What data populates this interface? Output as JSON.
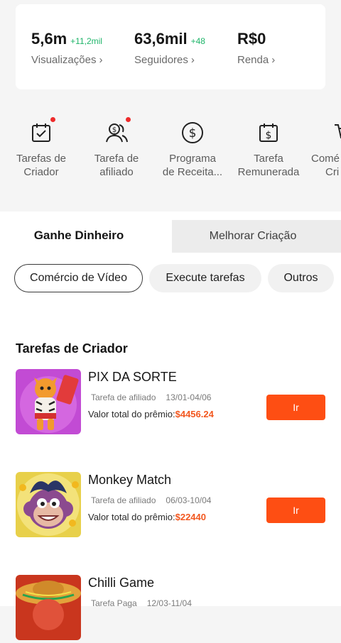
{
  "stats": [
    {
      "value": "5,6m",
      "delta": "+11,2mil",
      "label": "Visualizações",
      "chevron": "›"
    },
    {
      "value": "63,6mil",
      "delta": "+48",
      "label": "Seguidores",
      "chevron": "›"
    },
    {
      "value": "R$0",
      "delta": "",
      "label": "Renda",
      "chevron": "›"
    }
  ],
  "shortcuts": [
    {
      "icon": "calendar-check-icon",
      "line1": "Tarefas de",
      "line2": "Criador",
      "badge": true
    },
    {
      "icon": "dollar-people-icon",
      "line1": "Tarefa de",
      "line2": "afiliado",
      "badge": true
    },
    {
      "icon": "dollar-circle-icon",
      "line1": "Programa",
      "line2": "de Receita...",
      "badge": false
    },
    {
      "icon": "dollar-calendar-icon",
      "line1": "Tarefa",
      "line2": "Remunerada",
      "badge": false
    },
    {
      "icon": "cart-icon",
      "line1": "Comé",
      "line2": "Cri",
      "badge": false
    }
  ],
  "tabs": {
    "active": "Ganhe Dinheiro",
    "inactive": "Melhorar Criação"
  },
  "chips": [
    "Comércio de Vídeo",
    "Execute tarefas",
    "Outros"
  ],
  "section_title": "Tarefas de Criador",
  "tasks": [
    {
      "name": "PIX DA SORTE",
      "type": "Tarefa de afiliado",
      "dates": "13/01-04/06",
      "prize_label": "Valor total do prêmio:",
      "prize_amount": "$4456.24",
      "button": "Ir",
      "thumb": "tiger-game-thumbnail"
    },
    {
      "name": "Monkey Match",
      "type": "Tarefa de afiliado",
      "dates": "06/03-10/04",
      "prize_label": "Valor total do prêmio:",
      "prize_amount": "$22440",
      "button": "Ir",
      "thumb": "monkey-game-thumbnail"
    },
    {
      "name": "Chilli Game",
      "type": "Tarefa Paga",
      "dates": "12/03-11/04",
      "prize_label": "",
      "prize_amount": "",
      "button": "",
      "thumb": "chilli-game-thumbnail"
    }
  ],
  "colors": {
    "accent": "#fe4e13",
    "delta_green": "#1fb56a",
    "prize_orange": "#f2571f",
    "badge_red": "#ee2b2b"
  }
}
